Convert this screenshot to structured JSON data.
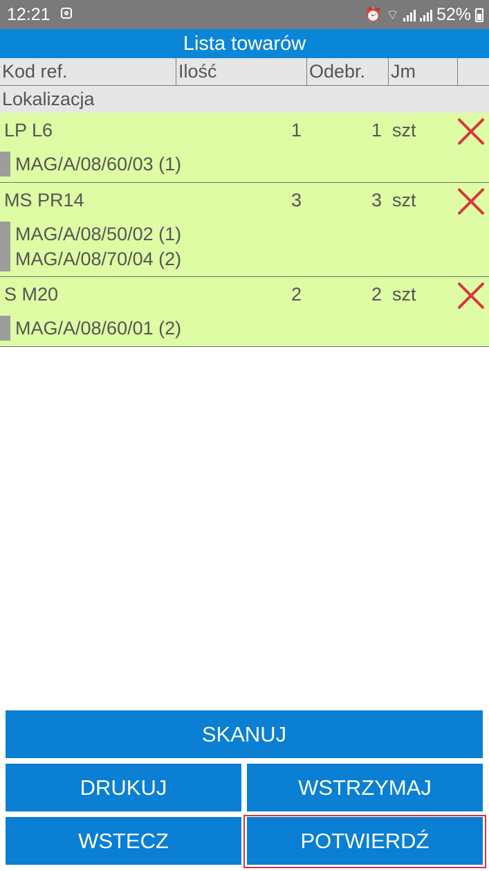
{
  "status_bar": {
    "time": "12:21",
    "battery": "52%",
    "icons": [
      "notification-app-icon",
      "alarm-icon",
      "wifi-icon",
      "signal-icon",
      "signal-icon",
      "battery-icon"
    ]
  },
  "title": "Lista towarów",
  "header": {
    "row1": [
      "Kod ref.",
      "Ilość",
      "Odebr.",
      "Jm",
      ""
    ],
    "row2": "Lokalizacja"
  },
  "items": [
    {
      "code": "LP L6",
      "qty": "1",
      "received": "1",
      "unit": "szt",
      "locations": [
        "MAG/A/08/60/03 (1)"
      ]
    },
    {
      "code": "MS PR14",
      "qty": "3",
      "received": "3",
      "unit": "szt",
      "locations": [
        "MAG/A/08/50/02 (1)",
        "MAG/A/08/70/04 (2)"
      ]
    },
    {
      "code": "S M20",
      "qty": "2",
      "received": "2",
      "unit": "szt",
      "locations": [
        "MAG/A/08/60/01 (2)"
      ]
    }
  ],
  "buttons": {
    "scan": "SKANUJ",
    "print": "DRUKUJ",
    "hold": "WSTRZYMAJ",
    "back": "WSTECZ",
    "confirm": "POTWIERDŹ"
  },
  "colors": {
    "title_bar": "#0a86d9",
    "button": "#0a7fd3",
    "row_bg": "#ddfca3",
    "delete": "#d7383f",
    "highlight": "#d33333"
  }
}
